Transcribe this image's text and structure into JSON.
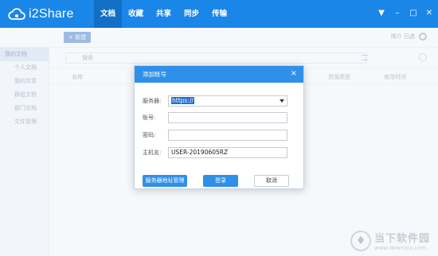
{
  "app": {
    "name": "i2Share",
    "nav": [
      "文档",
      "收藏",
      "共享",
      "同步",
      "传输"
    ],
    "active_nav": 0,
    "window_controls": [
      "▼",
      "–",
      "□",
      "✕"
    ]
  },
  "toolbar": {
    "primary_button": "+ 新建",
    "right_label": "简介 已选"
  },
  "sidebar": {
    "items": [
      "我的文档",
      "个人文档",
      "我的共享",
      "群组文档",
      "部门文档",
      "文件管理"
    ]
  },
  "main": {
    "search_placeholder": "搜索",
    "columns": [
      "名称",
      "资源类型",
      "修改时间"
    ]
  },
  "dialog": {
    "title": "添加账号",
    "close": "×",
    "server_label": "服务器:",
    "server_value": "https://",
    "account_label": "账号:",
    "account_value": "",
    "password_label": "密码:",
    "password_value": "",
    "hostname_label": "主机名:",
    "hostname_value": "USER-20190605RZ",
    "manage_button": "服务器地址管理",
    "login_button": "登录",
    "cancel_button": "取消"
  },
  "watermark": {
    "title": "当下软件园",
    "url": "www.downxia.com"
  },
  "colors": {
    "brand": "#1a86e8",
    "dialog_header": "#2e90e8"
  }
}
